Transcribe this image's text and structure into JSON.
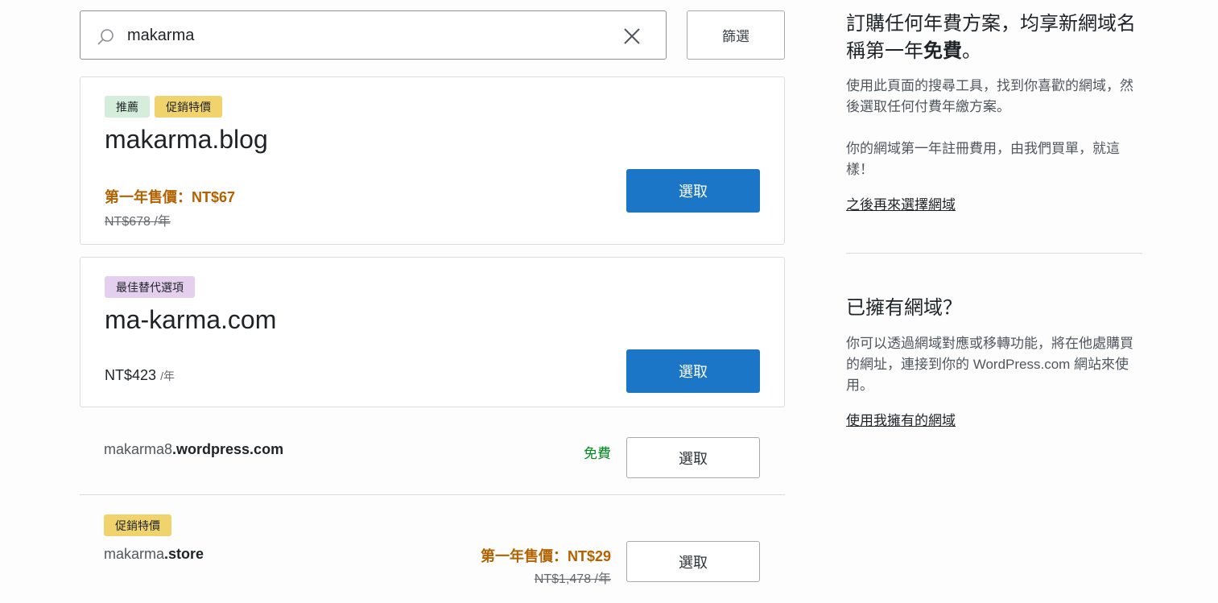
{
  "search": {
    "value": "makarma",
    "filter_label": "篩選"
  },
  "results": {
    "recommended": {
      "badges": [
        "推薦",
        "促銷特價"
      ],
      "domain": "makarma.blog",
      "sale_price": "第一年售價：NT$67",
      "old_price": "NT$678 /年",
      "select_label": "選取"
    },
    "alternative": {
      "badge": "最佳替代選項",
      "domain": "ma-karma.com",
      "price": "NT$423",
      "per": "/年",
      "select_label": "選取"
    },
    "free_row": {
      "domain_prefix": "makarma8",
      "domain_suffix": ".wordpress.com",
      "price": "免費",
      "select_label": "選取"
    },
    "store_row": {
      "badge": "促銷特價",
      "domain_prefix": "makarma",
      "domain_suffix": ".store",
      "sale_price": "第一年售價：NT$29",
      "old_price": "NT$1,478 /年",
      "select_label": "選取"
    }
  },
  "sidebar": {
    "promo": {
      "title_start": "訂購任何年費方案，均享新網域名稱第一年",
      "title_bold": "免費",
      "title_end": "。",
      "text1": "使用此頁面的搜尋工具，找到你喜歡的網域，然後選取任何付費年繳方案。",
      "text2": "你的網域第一年註冊費用，由我們買單，就這樣！",
      "link": "之後再來選擇網域"
    },
    "own": {
      "title": "已擁有網域？",
      "text": "你可以透過網域對應或移轉功能，將在他處購買的網址，連接到你的 WordPress.com 網站來使用。",
      "link": "使用我擁有的網域"
    }
  },
  "colors": {
    "primary_button": "#1c76c8",
    "sale_text": "#b26200",
    "free_text": "#008a20",
    "badge_green": "#d4eedb",
    "badge_yellow": "#f0d36c",
    "badge_purple": "#e5cfee"
  }
}
